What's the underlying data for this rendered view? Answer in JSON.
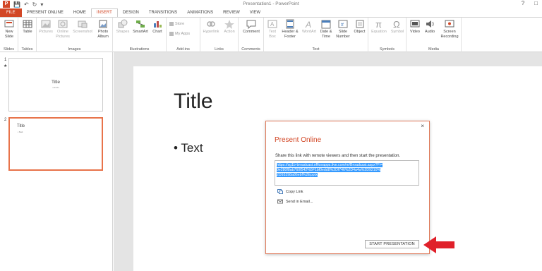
{
  "window": {
    "title": "Presentation1 - PowerPoint"
  },
  "quick_access": {
    "logo": "P",
    "save_icon": "save-icon",
    "undo_icon": "undo-icon",
    "redo_icon": "redo-icon"
  },
  "tabs": [
    "FILE",
    "PRESENT ONLINE",
    "HOME",
    "INSERT",
    "DESIGN",
    "TRANSITIONS",
    "ANIMATIONS",
    "REVIEW",
    "VIEW"
  ],
  "ribbon": {
    "slides": {
      "label": "Slides",
      "new_slide": "New Slide"
    },
    "tables": {
      "label": "Tables",
      "table": "Table"
    },
    "images": {
      "label": "Images",
      "pictures": "Pictures",
      "online_pictures": "Online Pictures",
      "screenshot": "Screenshot",
      "photo_album": "Photo Album"
    },
    "illustrations": {
      "label": "Illustrations",
      "shapes": "Shapes",
      "smartart": "SmartArt",
      "chart": "Chart"
    },
    "addins": {
      "label": "Add-ins",
      "store": "Store",
      "my_apps": "My Apps"
    },
    "links": {
      "label": "Links",
      "hyperlink": "Hyperlink",
      "action": "Action"
    },
    "comments": {
      "label": "Comments",
      "comment": "Comment"
    },
    "text": {
      "label": "Text",
      "text_box": "Text Box",
      "header_footer": "Header & Footer",
      "wordart": "WordArt",
      "date_time": "Date & Time",
      "slide_number": "Slide Number",
      "object": "Object"
    },
    "symbols": {
      "label": "Symbols",
      "equation": "Equation",
      "symbol": "Symbol"
    },
    "media": {
      "label": "Media",
      "video": "Video",
      "audio": "Audio",
      "screen_recording": "Screen Recording"
    }
  },
  "slides": [
    {
      "number": "1",
      "title": "Title",
      "subtitle": "subtitle"
    },
    {
      "number": "2",
      "title": "Title",
      "bullet": "• Text"
    }
  ],
  "current_slide": {
    "title": "Title",
    "bullet": "• Text"
  },
  "dialog": {
    "title": "Present Online",
    "description": "Share this link with remote viewers and then start the presentation.",
    "url_lines": [
      "https://sg1b-broadcast.officeapps.live.com/m/Broadcast.aspx?Fi=",
      "0e280f8ab760f542%5F1bf0edd8%2Df746%2D4a4a%2D9210%",
      "2D93398a86ebf%2Epptx"
    ],
    "copy_link": "Copy Link",
    "send_email": "Send in Email...",
    "start_button": "START PRESENTATION",
    "close": "×"
  },
  "colors": {
    "accent": "#d24726",
    "arrow": "#e0202a",
    "selection": "#3399ff"
  }
}
